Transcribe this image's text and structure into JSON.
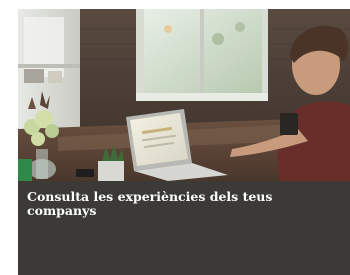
{
  "card": {
    "title": "Consulta les experiències dels teus companys",
    "image_description_icon": "office-photo-person-laptop",
    "background_color": "#3b3a36",
    "text_color": "#ffffff"
  }
}
